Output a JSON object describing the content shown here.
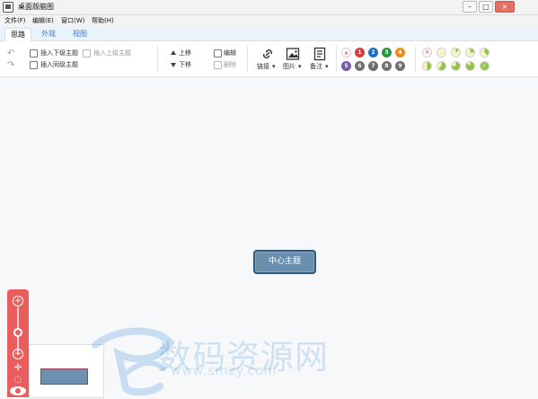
{
  "window": {
    "title": "桌面版脑图",
    "controls": [
      "–",
      "□",
      "×"
    ]
  },
  "menu": {
    "items": [
      "文件(F)",
      "编辑(E)",
      "窗口(W)",
      "帮助(H)"
    ]
  },
  "tabs": [
    {
      "label": "思路",
      "active": true
    },
    {
      "label": "外观",
      "active": false
    },
    {
      "label": "视图",
      "active": false
    }
  ],
  "toolbar": {
    "insert_child": "插入下级主题",
    "insert_parent": "插入上级主题",
    "insert_sibling": "插入同级主题",
    "move_up": "上移",
    "move_down": "下移",
    "edit": "编辑",
    "delete": "删除",
    "link": "链接",
    "image": "图片",
    "note": "备注",
    "dropdown_arrow": "▾",
    "priorities": [
      "×",
      "1",
      "2",
      "3",
      "4",
      "5",
      "6",
      "7",
      "8",
      "9"
    ],
    "priority_colors": [
      "#d44b4b",
      "#d93b3b",
      "#1f6fc2",
      "#2c9448",
      "#f08b1b",
      "#7a57ae",
      "#6f6f6f",
      "#6f6f6f",
      "#6f6f6f",
      "#6f6f6f"
    ],
    "progress_levels": [
      0,
      0,
      0.125,
      0.25,
      0.375,
      0.5,
      0.625,
      0.75,
      0.875,
      1
    ],
    "progress_color": "#93c24c"
  },
  "canvas": {
    "central_topic": "中心主题",
    "watermark_main": "数码资源网",
    "watermark_sub": "www.smzy.com"
  },
  "zoom": {
    "zoom_in": "+",
    "zoom_out": "−",
    "move": "✛",
    "fit": "◌"
  },
  "colors": {
    "tab_accent": "#3d7cc1",
    "central_fill": "#6a8fae",
    "central_border": "#315a7a",
    "zoom_panel": "#e95e5c"
  }
}
